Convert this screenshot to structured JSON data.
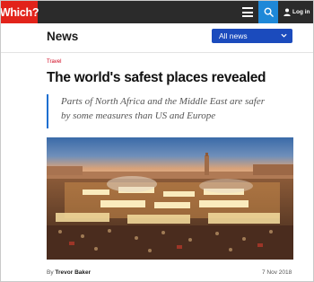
{
  "brand": {
    "logo_text": "Which?"
  },
  "topbar": {
    "login_label": "Log in"
  },
  "section": {
    "title": "News",
    "filter_selected": "All news"
  },
  "article": {
    "category": "Travel",
    "headline": "The world's safest places revealed",
    "standfirst_line1": "Parts of North Africa and the Middle East are safer",
    "standfirst_line2": "by some measures than US and Europe",
    "byline_prefix": "By",
    "author": "Trevor Baker",
    "date": "7 Nov 2018"
  },
  "colors": {
    "brand_red": "#e2231a",
    "topbar_bg": "#2b2b2b",
    "search_blue": "#1e88d8",
    "button_blue": "#1b4bbd",
    "category_red": "#d0021b"
  },
  "icons": [
    "menu-icon",
    "search-icon",
    "user-icon",
    "chevron-down-icon"
  ]
}
